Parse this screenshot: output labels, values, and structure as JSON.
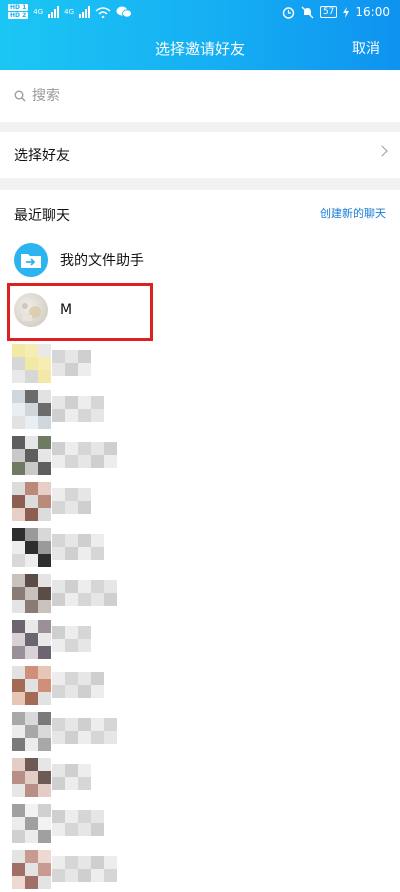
{
  "status": {
    "hd1": "HD 1",
    "hd2": "HD 2",
    "net1": "4G",
    "net2": "4G",
    "battery": "57",
    "time": "16:00"
  },
  "header": {
    "title": "选择邀请好友",
    "cancel": "取消"
  },
  "search": {
    "placeholder": "搜索"
  },
  "select_friends": {
    "label": "选择好友"
  },
  "recent": {
    "title": "最近聊天",
    "new_chat": "创建新的聊天"
  },
  "contacts": [
    {
      "name": "我的文件助手"
    },
    {
      "name": "M"
    }
  ],
  "colors": {
    "header_start": "#1cc6f4",
    "header_end": "#0e93f0",
    "link": "#1a7bd6",
    "highlight": "#e02020"
  }
}
